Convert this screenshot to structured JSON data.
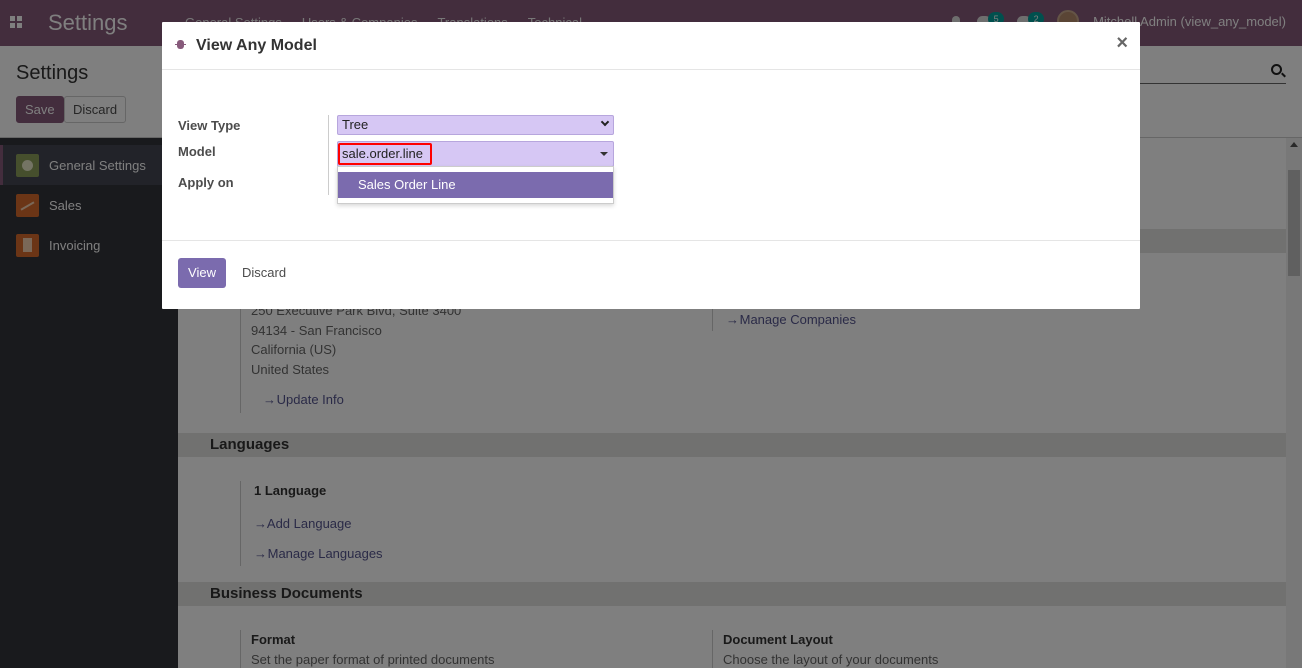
{
  "navbar": {
    "app_title": "Settings",
    "menu": [
      "General Settings",
      "Users & Companies",
      "Translations",
      "Technical"
    ],
    "messages_count": "5",
    "activities_count": "2",
    "user": "Mitchell Admin (view_any_model)"
  },
  "control_panel": {
    "title": "Settings",
    "save_label": "Save",
    "discard_label": "Discard"
  },
  "sidebar": {
    "items": [
      {
        "label": "General Settings"
      },
      {
        "label": "Sales"
      },
      {
        "label": "Invoicing"
      }
    ]
  },
  "content": {
    "address": [
      "250 Executive Park Blvd, Suite 3400",
      "94134 - San Francisco",
      "California (US)",
      "United States"
    ],
    "update_info": "Update Info",
    "manage_companies": "Manage Companies",
    "languages": {
      "title": "Languages",
      "count": "1 Language",
      "add": "Add Language",
      "manage": "Manage Languages"
    },
    "business_documents": {
      "title": "Business Documents",
      "format_title": "Format",
      "format_desc": "Set the paper format of printed documents",
      "layout_title": "Document Layout",
      "layout_desc": "Choose the layout of your documents"
    }
  },
  "modal": {
    "title": "View Any Model",
    "close": "×",
    "fields": {
      "view_type_label": "View Type",
      "view_type_value": "Tree",
      "model_label": "Model",
      "model_value": "sale.order.line",
      "apply_on_label": "Apply on"
    },
    "dropdown_options": [
      "Sales Order Line"
    ],
    "view_button": "View",
    "discard_button": "Discard"
  },
  "colors": {
    "brand": "#875a7b",
    "select_bg": "#d6c7f4",
    "primary_button": "#7b6bae",
    "highlight_border": "#ff0000"
  }
}
